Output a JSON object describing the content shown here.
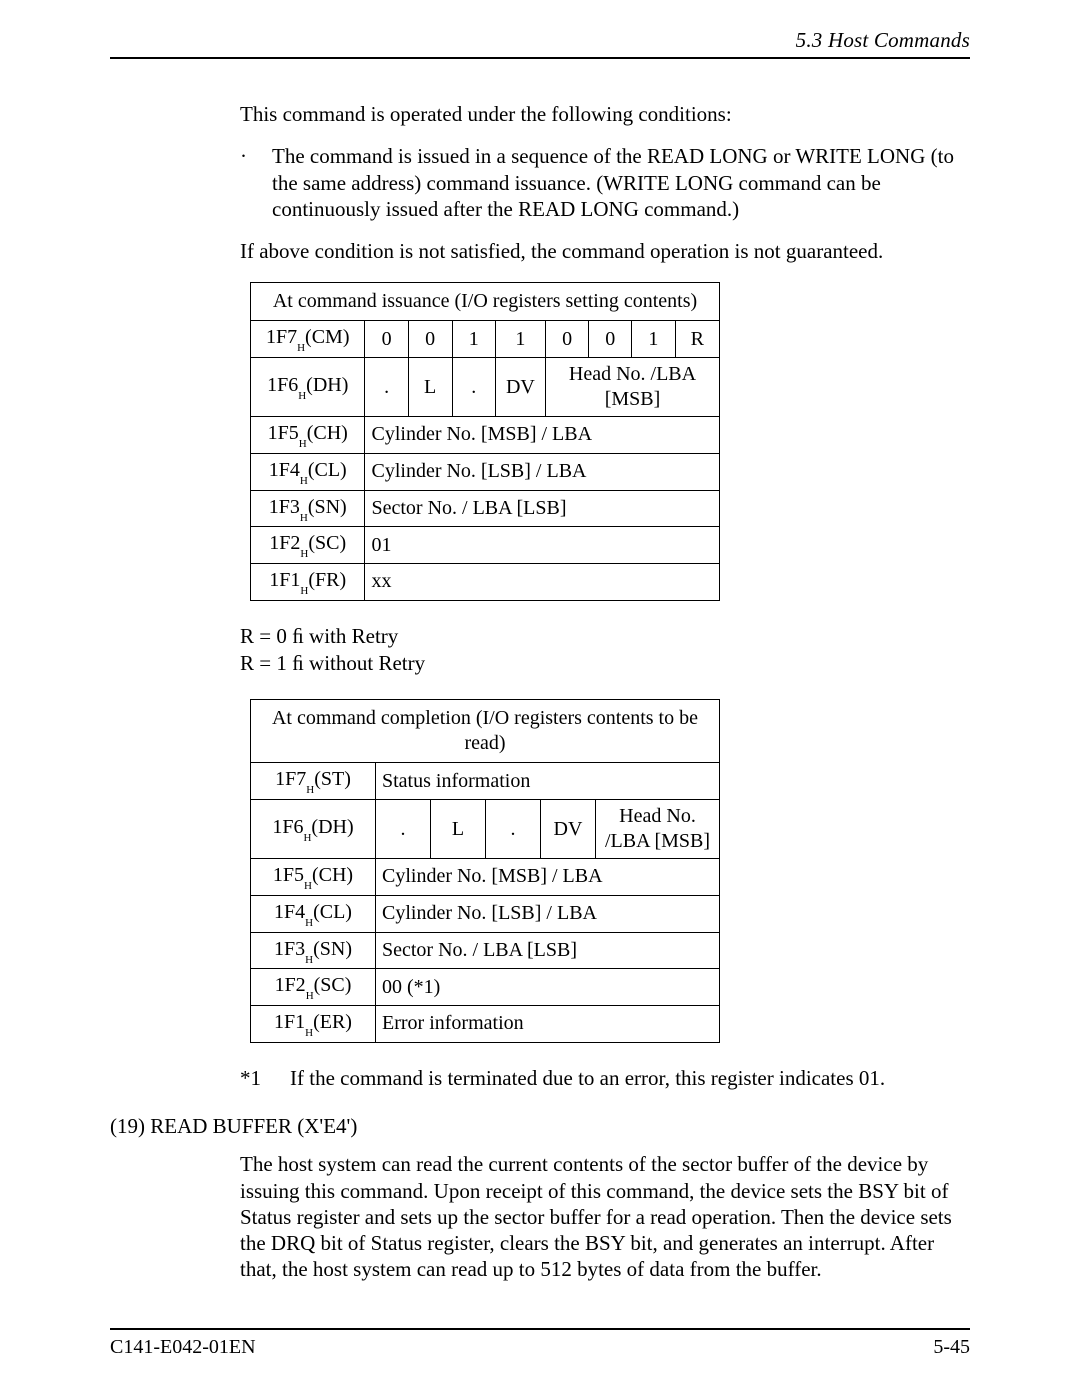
{
  "header": {
    "section_title": "5.3  Host Commands"
  },
  "intro": {
    "line1": "This command is operated under the following conditions:",
    "bullet_symbol": "·",
    "bullet1": "The command is issued in a sequence of the READ LONG or WRITE LONG (to the same address) command issuance.  (WRITE LONG command can be continuously issued after the READ LONG command.)",
    "line2": "If above condition is not satisfied, the command operation is not guaranteed."
  },
  "table1": {
    "title": "At command issuance (I/O registers setting contents)",
    "rows": {
      "cm": {
        "reg_base": "1F7",
        "reg_sub": "H",
        "reg_paren": "(CM)",
        "bits": [
          "0",
          "0",
          "1",
          "1",
          "0",
          "0",
          "1",
          "R"
        ]
      },
      "dh": {
        "reg_base": "1F6",
        "reg_sub": "H",
        "reg_paren": "(DH)",
        "b0": ".",
        "b1": "L",
        "b2": ".",
        "b3": "DV",
        "rest": "Head No. /LBA [MSB]"
      },
      "ch": {
        "reg_base": "1F5",
        "reg_sub": "H",
        "reg_paren": "(CH)",
        "val": "Cylinder No. [MSB] / LBA"
      },
      "cl": {
        "reg_base": "1F4",
        "reg_sub": "H",
        "reg_paren": "(CL)",
        "val": "Cylinder No. [LSB] / LBA"
      },
      "sn": {
        "reg_base": "1F3",
        "reg_sub": "H",
        "reg_paren": "(SN)",
        "val": "Sector No. / LBA [LSB]"
      },
      "sc": {
        "reg_base": "1F2",
        "reg_sub": "H",
        "reg_paren": "(SC)",
        "val": "01"
      },
      "fr": {
        "reg_base": "1F1",
        "reg_sub": "H",
        "reg_paren": "(FR)",
        "val": "xx"
      }
    }
  },
  "retry": {
    "line1": "R = 0 ﬁ  with Retry",
    "line2": "R = 1 ﬁ  without Retry"
  },
  "table2": {
    "title": "At command completion (I/O registers contents to be read)",
    "rows": {
      "st": {
        "reg_base": "1F7",
        "reg_sub": "H",
        "reg_paren": "(ST)",
        "val": "Status information"
      },
      "dh": {
        "reg_base": "1F6",
        "reg_sub": "H",
        "reg_paren": "(DH)",
        "b0": ".",
        "b1": "L",
        "b2": ".",
        "b3": "DV",
        "rest": "Head No. /LBA [MSB]"
      },
      "ch": {
        "reg_base": "1F5",
        "reg_sub": "H",
        "reg_paren": "(CH)",
        "val": "Cylinder No. [MSB] / LBA"
      },
      "cl": {
        "reg_base": "1F4",
        "reg_sub": "H",
        "reg_paren": "(CL)",
        "val": "Cylinder No. [LSB] / LBA"
      },
      "sn": {
        "reg_base": "1F3",
        "reg_sub": "H",
        "reg_paren": "(SN)",
        "val": "Sector No. / LBA [LSB]"
      },
      "sc": {
        "reg_base": "1F2",
        "reg_sub": "H",
        "reg_paren": "(SC)",
        "val": "00 (*1)"
      },
      "er": {
        "reg_base": "1F1",
        "reg_sub": "H",
        "reg_paren": "(ER)",
        "val": "Error information"
      }
    }
  },
  "footnote": {
    "mark": "*1",
    "text": "If the command is terminated due to an error, this register indicates 01."
  },
  "section": {
    "heading": "(19)  READ BUFFER (X'E4')",
    "para": "The host system can read the current contents of the sector buffer of the device by issuing this command.  Upon receipt of this command, the device sets the BSY bit of Status register and sets up the sector buffer for a read operation.  Then the device sets the DRQ bit of Status register, clears the BSY bit, and generates an interrupt.  After that, the host system can read up to 512 bytes of data from the buffer."
  },
  "footer": {
    "doc_id": "C141-E042-01EN",
    "page_no": "5-45"
  }
}
